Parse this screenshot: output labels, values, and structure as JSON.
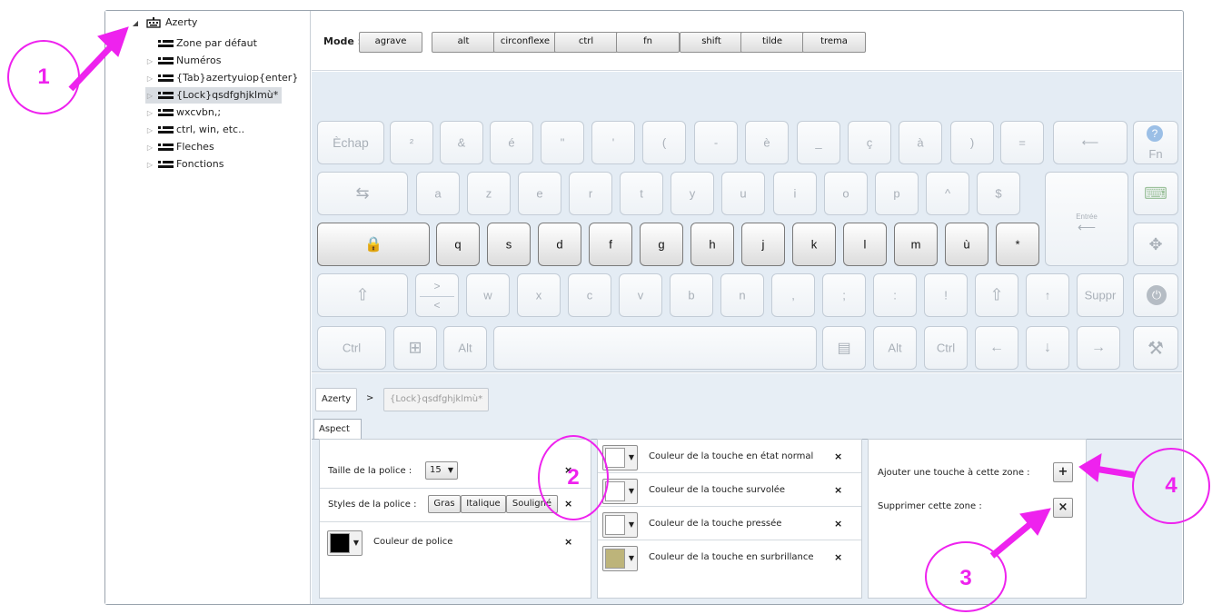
{
  "tree": {
    "root": "Azerty",
    "items": [
      {
        "label": "Zone par défaut",
        "expandable": false,
        "selected": false
      },
      {
        "label": "Numéros",
        "expandable": true,
        "selected": false
      },
      {
        "label": "{Tab}azertyuiop{enter}",
        "expandable": true,
        "selected": false
      },
      {
        "label": "{Lock}qsdfghjklmù*",
        "expandable": true,
        "selected": true
      },
      {
        "label": "wxcvbn,;",
        "expandable": true,
        "selected": false
      },
      {
        "label": "ctrl, win, etc..",
        "expandable": true,
        "selected": false
      },
      {
        "label": "Fleches",
        "expandable": true,
        "selected": false
      },
      {
        "label": "Fonctions",
        "expandable": true,
        "selected": false
      }
    ]
  },
  "mode": {
    "label": "Mode :",
    "buttons": [
      "agrave",
      "alt",
      "circonflexe",
      "ctrl",
      "fn",
      "shift",
      "tilde",
      "trema"
    ]
  },
  "keyboard": {
    "row1": [
      "Èchap",
      "²",
      "&",
      "é",
      "\"",
      "'",
      "(",
      "-",
      "è",
      "_",
      "ç",
      "à",
      ")",
      "=",
      "⟵"
    ],
    "row2": [
      "⇆",
      "a",
      "z",
      "e",
      "r",
      "t",
      "y",
      "u",
      "i",
      "o",
      "p",
      "^",
      "$"
    ],
    "enter_label": "Entrée",
    "row3": [
      "🔒",
      "q",
      "s",
      "d",
      "f",
      "g",
      "h",
      "j",
      "k",
      "l",
      "m",
      "ù",
      "*"
    ],
    "row4": [
      "⇧",
      "> <",
      "w",
      "x",
      "c",
      "v",
      "b",
      "n",
      ",",
      ";",
      ":",
      "!",
      "⇧",
      "↑",
      "Suppr"
    ],
    "row5": [
      "Ctrl",
      "⊞",
      "Alt",
      "",
      "▤",
      "Alt",
      "Ctrl",
      "←",
      "↓",
      "→"
    ],
    "side_fn": "Fn",
    "side_fn_top": "?"
  },
  "breadcrumb": {
    "root": "Azerty",
    "separator": ">",
    "current": "{Lock}qsdfghjklmù*"
  },
  "tab": "Aspect",
  "font_group": {
    "size_label": "Taille de la police :",
    "size_value": "15",
    "styles_label": "Styles de la police :",
    "styles": [
      "Gras",
      "Italique",
      "Souligné"
    ],
    "color_label": "Couleur de police",
    "color": "#000000"
  },
  "key_colors": {
    "items": [
      {
        "label": "Couleur de la touche en état normal",
        "color": "#ffffff"
      },
      {
        "label": "Couleur de la touche survolée",
        "color": "#ffffff"
      },
      {
        "label": "Couleur de la touche pressée",
        "color": "#ffffff"
      },
      {
        "label": "Couleur de la touche en surbrillance",
        "color": "#bdb47a"
      }
    ]
  },
  "zone": {
    "add_label": "Ajouter une touche à cette zone :",
    "remove_label": "Supprimer cette zone :"
  },
  "close_glyph": "×",
  "add_glyph": "+",
  "annotations": [
    "1",
    "2",
    "3",
    "4"
  ],
  "colors": {
    "annotation": "#ee22ee"
  }
}
